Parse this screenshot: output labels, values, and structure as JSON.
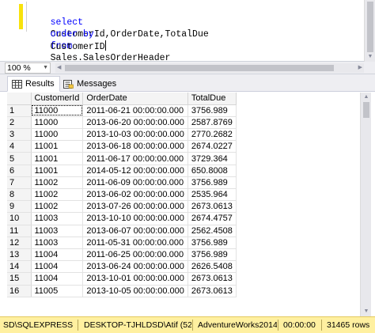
{
  "editor": {
    "line1": {
      "kw1": "select",
      "text1": "CustomerId,OrderDate,TotalDue",
      "kw2": "from",
      "text2": "Sales.SalesOrderHeader"
    },
    "line2": {
      "kw1": "order by",
      "text1": "CustomerID"
    }
  },
  "zoom": {
    "value": "100 %"
  },
  "tabs": {
    "results": "Results",
    "messages": "Messages"
  },
  "grid": {
    "columns": [
      "CustomerId",
      "OrderDate",
      "TotalDue"
    ],
    "rows": [
      {
        "n": "1",
        "id": "11000",
        "date": "2011-06-21 00:00:00.000",
        "due": "3756.989"
      },
      {
        "n": "2",
        "id": "11000",
        "date": "2013-06-20 00:00:00.000",
        "due": "2587.8769"
      },
      {
        "n": "3",
        "id": "11000",
        "date": "2013-10-03 00:00:00.000",
        "due": "2770.2682"
      },
      {
        "n": "4",
        "id": "11001",
        "date": "2013-06-18 00:00:00.000",
        "due": "2674.0227"
      },
      {
        "n": "5",
        "id": "11001",
        "date": "2011-06-17 00:00:00.000",
        "due": "3729.364"
      },
      {
        "n": "6",
        "id": "11001",
        "date": "2014-05-12 00:00:00.000",
        "due": "650.8008"
      },
      {
        "n": "7",
        "id": "11002",
        "date": "2011-06-09 00:00:00.000",
        "due": "3756.989"
      },
      {
        "n": "8",
        "id": "11002",
        "date": "2013-06-02 00:00:00.000",
        "due": "2535.964"
      },
      {
        "n": "9",
        "id": "11002",
        "date": "2013-07-26 00:00:00.000",
        "due": "2673.0613"
      },
      {
        "n": "10",
        "id": "11003",
        "date": "2013-10-10 00:00:00.000",
        "due": "2674.4757"
      },
      {
        "n": "11",
        "id": "11003",
        "date": "2013-06-07 00:00:00.000",
        "due": "2562.4508"
      },
      {
        "n": "12",
        "id": "11003",
        "date": "2011-05-31 00:00:00.000",
        "due": "3756.989"
      },
      {
        "n": "13",
        "id": "11004",
        "date": "2011-06-25 00:00:00.000",
        "due": "3756.989"
      },
      {
        "n": "14",
        "id": "11004",
        "date": "2013-06-24 00:00:00.000",
        "due": "2626.5408"
      },
      {
        "n": "15",
        "id": "11004",
        "date": "2013-10-01 00:00:00.000",
        "due": "2673.0613"
      },
      {
        "n": "16",
        "id": "11005",
        "date": "2013-10-05 00:00:00.000",
        "due": "2673.0613"
      }
    ]
  },
  "statusbar": {
    "server": "SD\\SQLEXPRESS ...",
    "user": "DESKTOP-TJHLDSD\\Atif (52)",
    "database": "AdventureWorks2014",
    "elapsed": "00:00:00",
    "rows": "31465 rows"
  },
  "colors": {
    "status_bg": "#fff0a0",
    "keyword": "#0000ff",
    "change_bar": "#f8e20c"
  }
}
